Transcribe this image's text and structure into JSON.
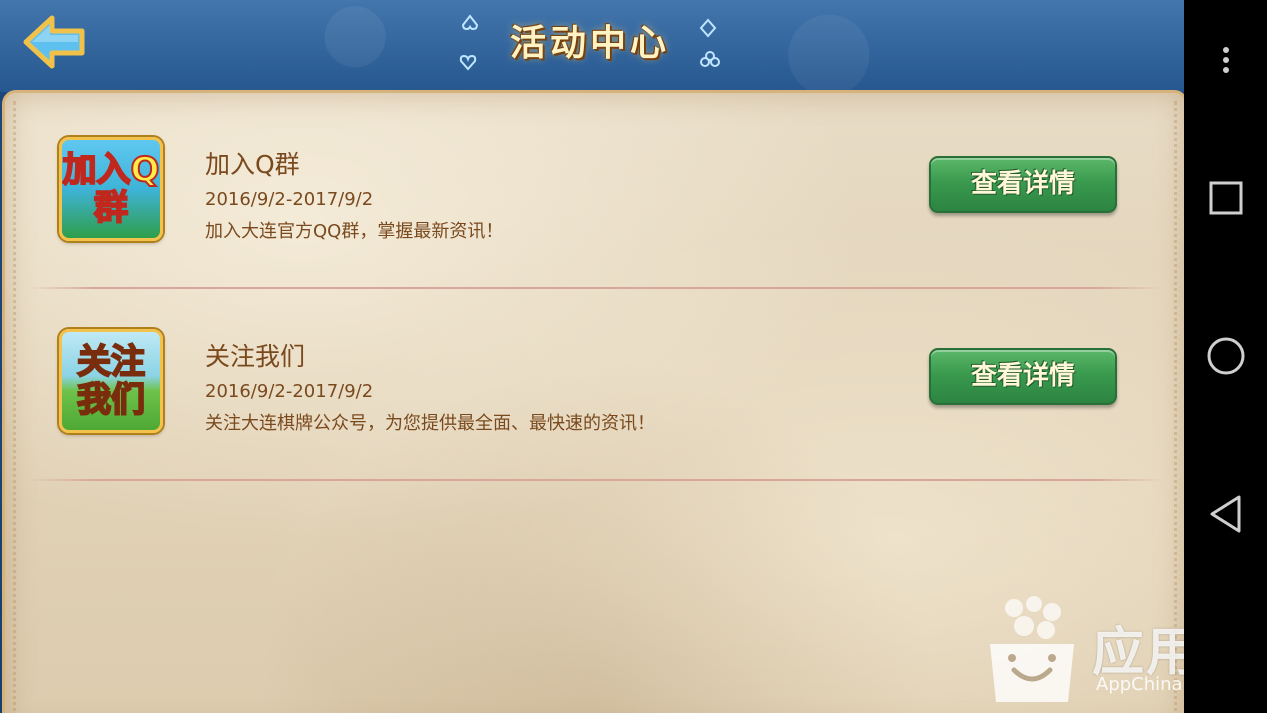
{
  "header": {
    "title": "活动中心",
    "back_label": "back"
  },
  "activities": [
    {
      "icon_text": "加入Q群",
      "title": "加入Q群",
      "date": "2016/9/2-2017/9/2",
      "description": "加入大连官方QQ群，掌握最新资讯！",
      "button_label": "查看详情"
    },
    {
      "icon_text": "关注我们",
      "title": "关注我们",
      "date": "2016/9/2-2017/9/2",
      "description": "关注大连棋牌公众号，为您提供最全面、最快速的资讯！",
      "button_label": "查看详情"
    }
  ],
  "watermark": {
    "brand": "应用汇",
    "site": "AppChina.com"
  },
  "navbar": {
    "icons": [
      "more-vert-icon",
      "recents-square-icon",
      "home-circle-icon",
      "back-triangle-icon"
    ]
  },
  "colors": {
    "header_blue": "#26578f",
    "panel_parchment": "#e3d4ba",
    "text_brown": "#7a4a1e",
    "button_green": "#3a9a4e",
    "title_gold": "#fff3c4"
  }
}
